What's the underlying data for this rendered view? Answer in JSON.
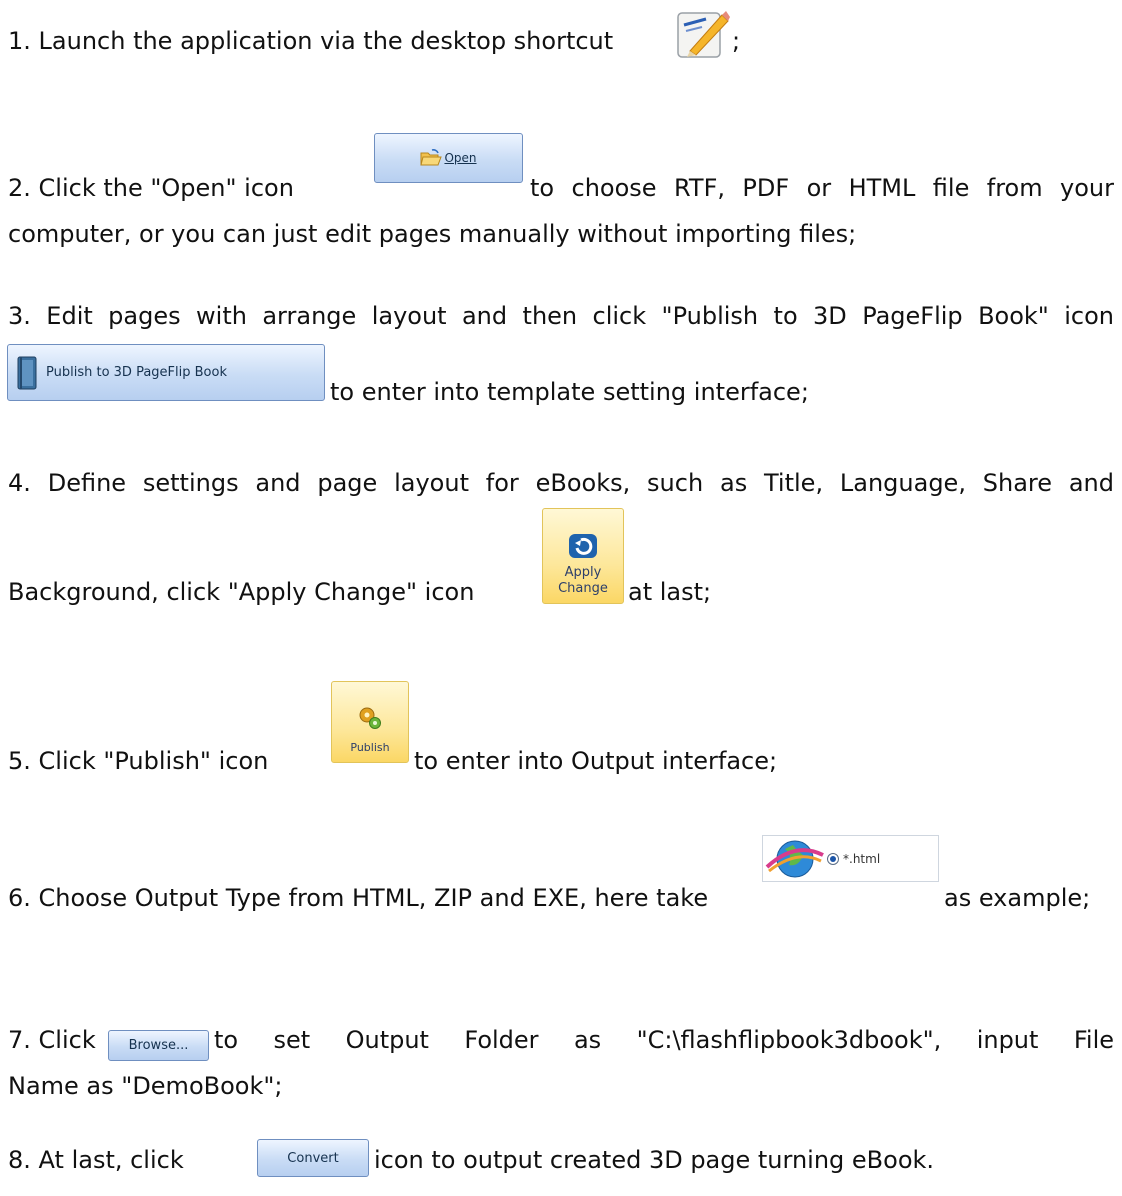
{
  "steps": [
    {
      "before": "1. Launch the application via the desktop shortcut",
      "after": ";"
    },
    {
      "before": "2. Click the \"Open\" icon",
      "after": "to choose RTF, PDF or HTML file from your",
      "cont": "computer, or you can just edit pages manually without importing files;"
    },
    {
      "line1": "3. Edit pages with arrange layout and then click \"Publish to 3D PageFlip Book\" icon",
      "after": "to enter into template setting interface;"
    },
    {
      "line1": "4. Define settings and page layout for eBooks, such as Title, Language, Share and",
      "before": "Background, click \"Apply Change\" icon",
      "after": "at last;"
    },
    {
      "before": "5. Click \"Publish\" icon",
      "after": "to enter into Output interface;"
    },
    {
      "before": "6. Choose Output Type from HTML, ZIP and EXE, here take",
      "after": "as example;"
    },
    {
      "before": "7. Click",
      "after": "to set Output Folder as \"C:\\flashflipbook3dbook\", input File",
      "cont": "Name as \"DemoBook\";"
    },
    {
      "before": "8. At last, click",
      "after": "icon to output created 3D page turning eBook."
    }
  ],
  "buttons": {
    "open": "Open",
    "publish3d": "Publish to 3D PageFlip Book",
    "apply_line1": "Apply",
    "apply_line2": "Change",
    "publish": "Publish",
    "html_option": "*.html",
    "browse": "Browse...",
    "convert": "Convert"
  }
}
